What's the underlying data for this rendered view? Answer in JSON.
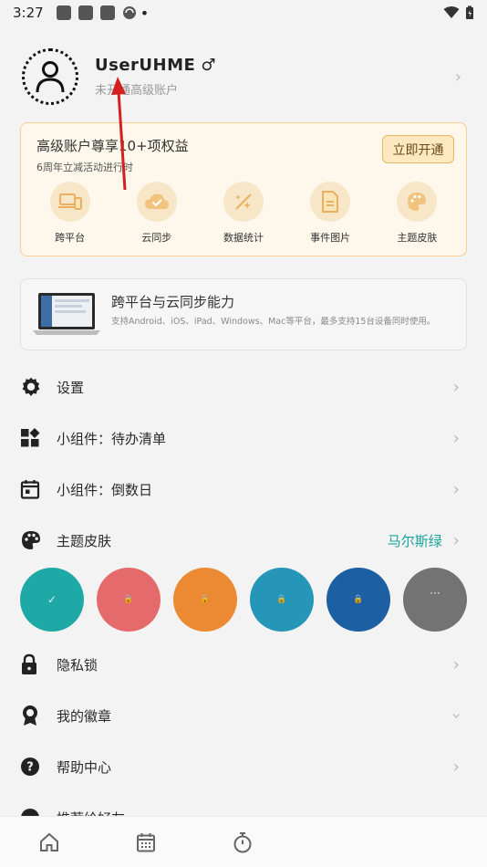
{
  "status_bar": {
    "time": "3:27",
    "dot": "•"
  },
  "profile": {
    "username": "UserUHME",
    "gender_symbol": "♂",
    "subtitle": "未开通高级账户"
  },
  "premium": {
    "title": "高级账户尊享10+项权益",
    "promo": "6周年立减活动进行时",
    "open_button": "立即开通",
    "benefits": [
      {
        "label": "跨平台",
        "icon": "devices-icon"
      },
      {
        "label": "云同步",
        "icon": "cloud-check-icon"
      },
      {
        "label": "数据统计",
        "icon": "sparkle-icon"
      },
      {
        "label": "事件图片",
        "icon": "document-icon"
      },
      {
        "label": "主题皮肤",
        "icon": "palette-icon"
      }
    ]
  },
  "cross_platform_card": {
    "title": "跨平台与云同步能力",
    "description": "支持Android、iOS、iPad、Windows、Mac等平台，最多支持15台设备同时使用。"
  },
  "menu": {
    "settings": "设置",
    "widget_todo": "小组件：待办清单",
    "widget_countdown": "小组件：倒数日",
    "theme": "主题皮肤",
    "theme_value": "马尔斯绿",
    "privacy_lock": "隐私锁",
    "badges": "我的徽章",
    "help": "帮助中心",
    "recommend": "推荐给好友"
  },
  "theme_swatches": [
    {
      "name": "teal",
      "color": "#1fa9a6",
      "state": "selected",
      "glyph": "✓"
    },
    {
      "name": "red",
      "color": "#e56a6c",
      "state": "locked",
      "glyph": "🔒"
    },
    {
      "name": "orange",
      "color": "#ec8a33",
      "state": "locked",
      "glyph": "🔒"
    },
    {
      "name": "cyan-blue",
      "color": "#2596b8",
      "state": "locked",
      "glyph": "🔒"
    },
    {
      "name": "navy",
      "color": "#1d5fa3",
      "state": "locked",
      "glyph": "🔒"
    },
    {
      "name": "gray-more",
      "color": "#737373",
      "state": "more",
      "glyph": "···"
    }
  ],
  "colors": {
    "accent": "#1aa39a",
    "premium_border": "#f3cf92",
    "arrow": "#d42020"
  }
}
